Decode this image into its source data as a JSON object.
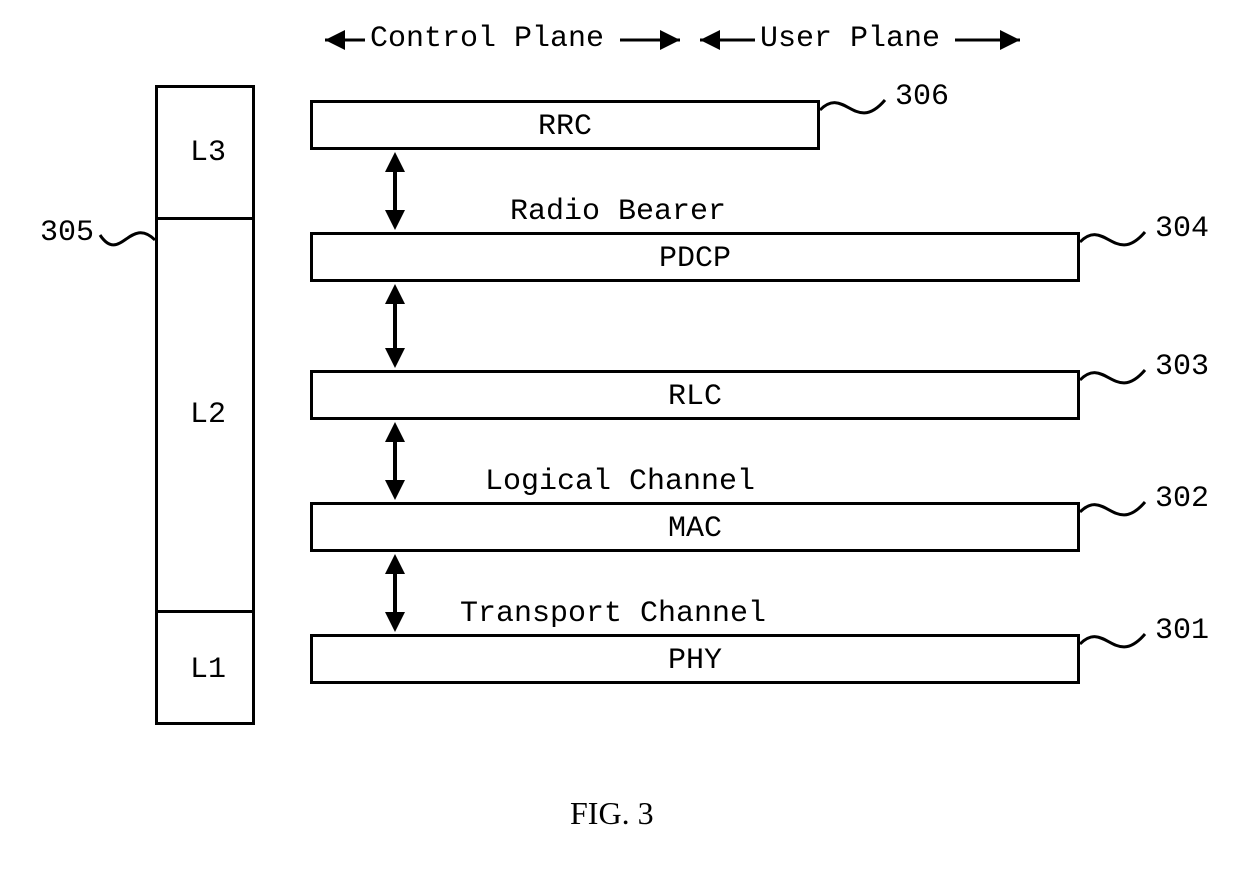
{
  "figure_caption": "FIG. 3",
  "plane_headers": {
    "control": "Control Plane",
    "user": "User Plane"
  },
  "left_column": {
    "l3": "L3",
    "l2": "L2",
    "l1": "L1"
  },
  "layers": {
    "rrc": {
      "name": "RRC",
      "ref": "306"
    },
    "pdcp": {
      "name": "PDCP",
      "ref": "304",
      "channel_above": "Radio Bearer"
    },
    "rlc": {
      "name": "RLC",
      "ref": "303"
    },
    "mac": {
      "name": "MAC",
      "ref": "302",
      "channel_above": "Logical Channel"
    },
    "phy": {
      "name": "PHY",
      "ref": "301",
      "channel_above": "Transport Channel"
    }
  },
  "left_ref": "305"
}
